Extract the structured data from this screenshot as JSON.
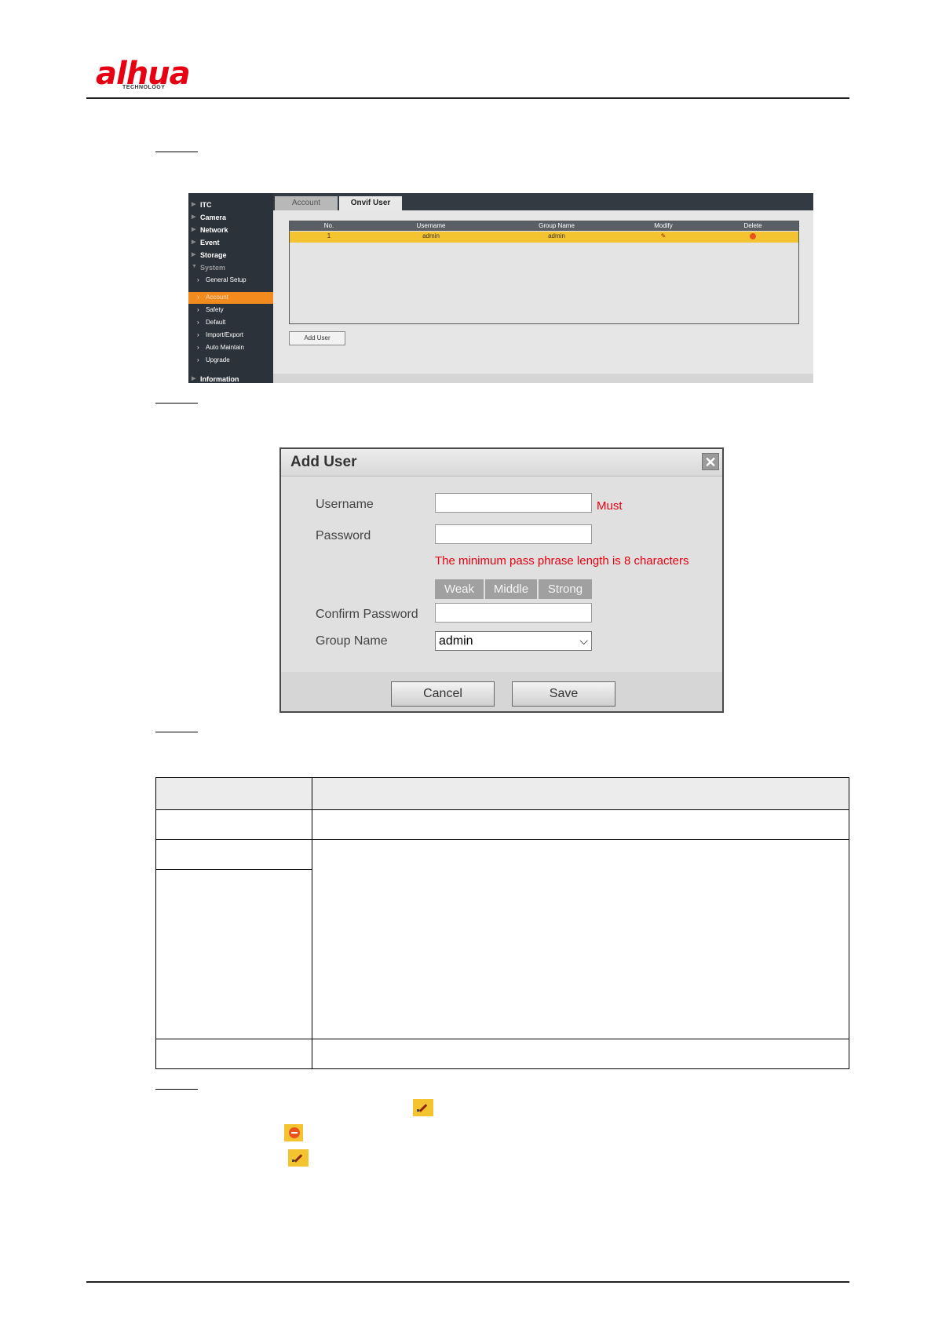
{
  "header": {
    "logo_text": "alhua",
    "logo_subtext": "TECHNOLOGY"
  },
  "screenshot_account": {
    "tabs": [
      "Account",
      "Onvif User"
    ],
    "menu": [
      "ITC",
      "Camera",
      "Network",
      "Event",
      "Storage",
      "System"
    ],
    "submenu": [
      "General Setup",
      "Account",
      "Safety",
      "Default",
      "Import/Export",
      "Auto Maintain",
      "Upgrade"
    ],
    "menu_bottom": "Information",
    "table_headers": [
      "No.",
      "Username",
      "Group Name",
      "Modify",
      "Delete"
    ],
    "row": {
      "no": "1",
      "username": "admin",
      "group": "admin"
    },
    "add_user_label": "Add User",
    "colors": {
      "accent": "#f28a1e",
      "row_highlight": "#f4c430",
      "sidebar": "#2c3239"
    }
  },
  "dialog": {
    "title": "Add User",
    "close_glyph": "✕",
    "labels": {
      "username": "Username",
      "password": "Password",
      "confirm": "Confirm Password",
      "group": "Group Name"
    },
    "must": "Must",
    "password_hint": "The minimum pass phrase length is 8 characters",
    "strength": [
      "Weak",
      "Middle",
      "Strong"
    ],
    "group_value": "admin",
    "cancel": "Cancel",
    "save": "Save",
    "colors": {
      "warning": "#e60012"
    }
  },
  "icons": {
    "modify": "pencil-icon",
    "delete": "delete-icon"
  }
}
